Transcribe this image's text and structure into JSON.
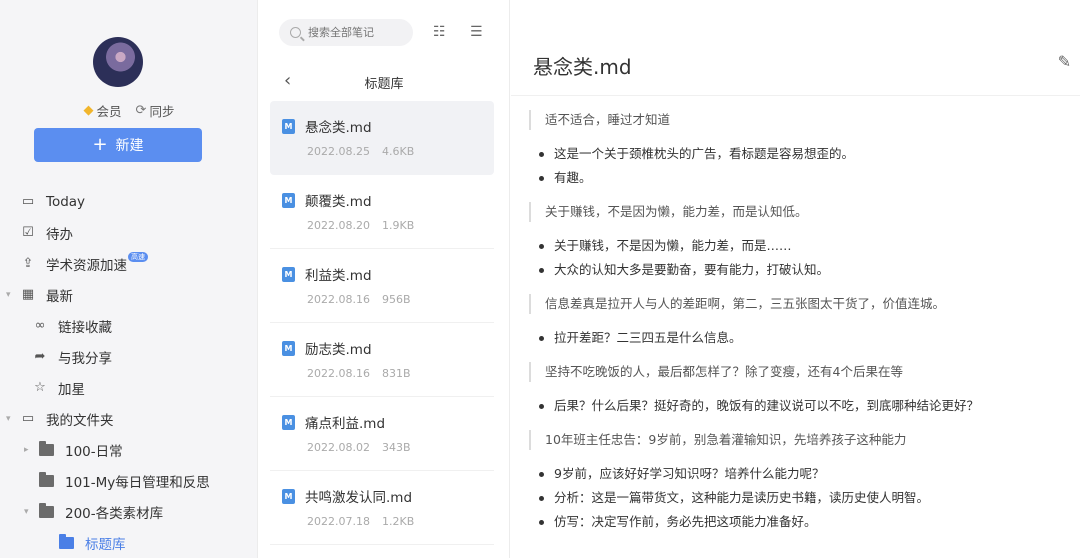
{
  "sidebar": {
    "member_label": "会员",
    "sync_label": "同步",
    "new_button": "新建",
    "nav": {
      "today": "Today",
      "todo": "待办",
      "academic": "学术资源加速",
      "academic_badge": "高速",
      "recent": "最新",
      "links": "链接收藏",
      "shared": "与我分享",
      "starred": "加星",
      "my_folders": "我的文件夹",
      "folder_100": "100-日常",
      "folder_101": "101-My每日管理和反思",
      "folder_200": "200-各类素材库",
      "folder_title_lib": "标题库"
    }
  },
  "list": {
    "search_placeholder": "搜索全部笔记",
    "title": "标题库",
    "notes": [
      {
        "title": "悬念类.md",
        "date": "2022.08.25",
        "size": "4.6KB"
      },
      {
        "title": "颠覆类.md",
        "date": "2022.08.20",
        "size": "1.9KB"
      },
      {
        "title": "利益类.md",
        "date": "2022.08.16",
        "size": "956B"
      },
      {
        "title": "励志类.md",
        "date": "2022.08.16",
        "size": "831B"
      },
      {
        "title": "痛点利益.md",
        "date": "2022.08.02",
        "size": "343B"
      },
      {
        "title": "共鸣激发认同.md",
        "date": "2022.07.18",
        "size": "1.2KB"
      }
    ]
  },
  "editor": {
    "doc_title": "悬念类.md",
    "content": {
      "q1": "适不适合，睡过才知道",
      "b1": [
        "这是一个关于颈椎枕头的广告，看标题是容易想歪的。",
        "有趣。"
      ],
      "q2": "关于赚钱，不是因为懒，能力差，而是认知低。",
      "b2": [
        "关于赚钱，不是因为懒，能力差，而是……",
        "大众的认知大多是要勤奋，要有能力，打破认知。"
      ],
      "q3": "信息差真是拉开人与人的差距啊，第二，三五张图太干货了，价值连城。",
      "b3": [
        "拉开差距？二三四五是什么信息。"
      ],
      "q4": "坚持不吃晚饭的人，最后都怎样了？除了变瘦，还有4个后果在等",
      "b4": [
        "后果？什么后果？挺好奇的，晚饭有的建议说可以不吃，到底哪种结论更好？"
      ],
      "q5": "10年班主任忠告：9岁前，别急着灌输知识，先培养孩子这种能力",
      "b5": [
        "9岁前，应该好好学习知识呀？培养什么能力呢？",
        "分析：这是一篇带货文，这种能力是读历史书籍，读历史使人明智。",
        "仿写：决定写作前，务必先把这项能力准备好。"
      ]
    }
  },
  "colors": {
    "accent": "#5b8ef0",
    "sidebar_bg": "#f5f5f7",
    "vip": "#f1b52c"
  }
}
